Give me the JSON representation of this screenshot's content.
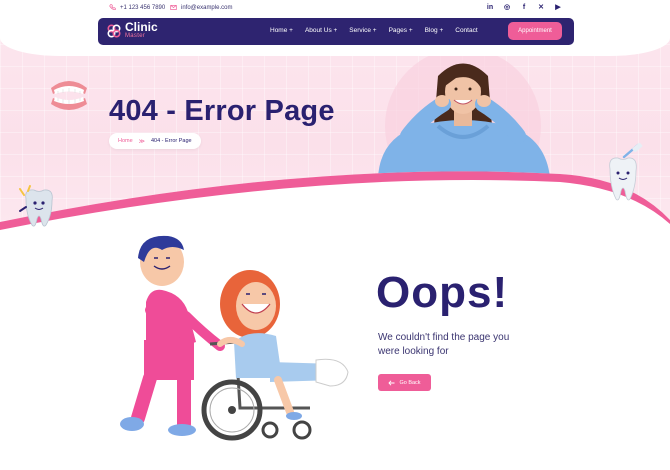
{
  "topbar": {
    "phone": "+1 123 456 7890",
    "email": "info@example.com",
    "social_icons": [
      "linkedin-icon",
      "instagram-icon",
      "facebook-icon",
      "x-icon",
      "youtube-icon"
    ],
    "social_glyphs": [
      "in",
      "◎",
      "f",
      "✕",
      "▶"
    ]
  },
  "logo": {
    "title": "Clinic",
    "subtitle": "Master"
  },
  "nav": {
    "items": [
      {
        "label": "Home +"
      },
      {
        "label": "About Us +"
      },
      {
        "label": "Service +"
      },
      {
        "label": "Pages +"
      },
      {
        "label": "Blog +"
      },
      {
        "label": "Contact"
      }
    ],
    "cta": "Appointment"
  },
  "hero": {
    "title": "404 - Error Page",
    "breadcrumb": {
      "home": "Home",
      "separator": "≫",
      "current": "404 - Error Page"
    }
  },
  "error": {
    "heading": "Oops!",
    "message": "We couldn't find the page you were looking for",
    "button": "Go Back"
  },
  "colors": {
    "brand_navy": "#2e2470",
    "accent_pink": "#ef5d98",
    "hero_bg": "#fde7ef"
  }
}
